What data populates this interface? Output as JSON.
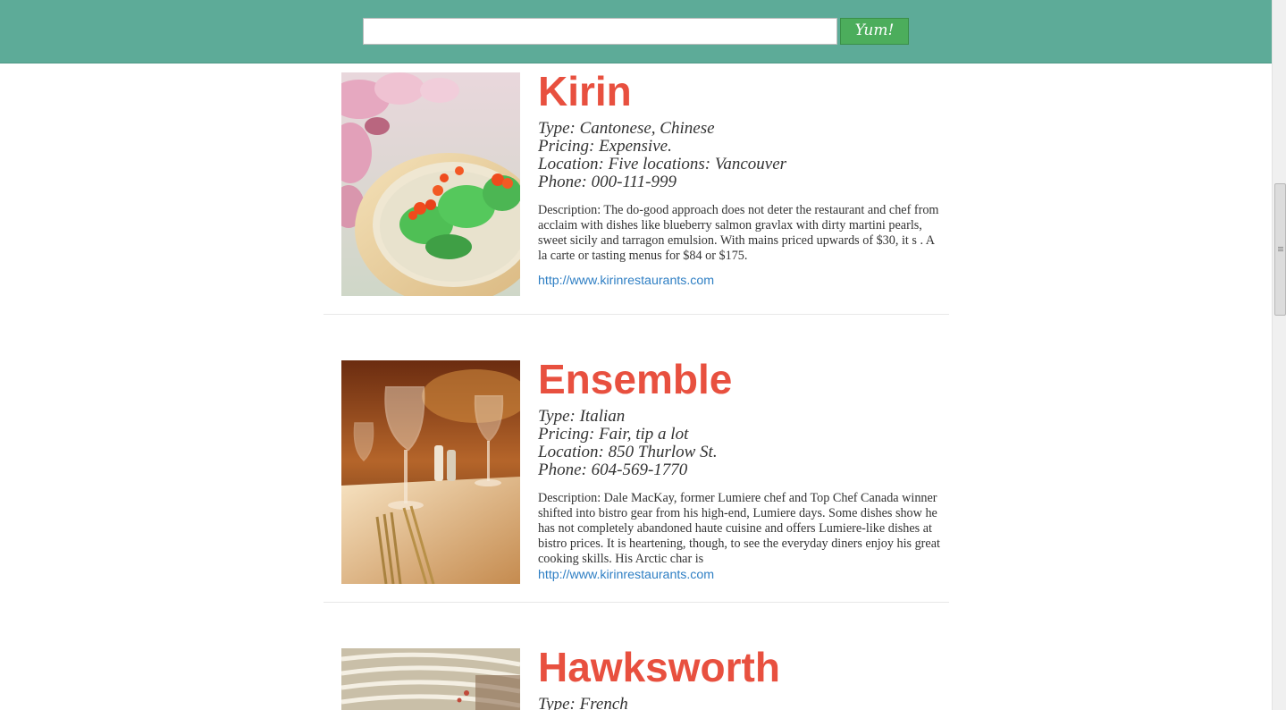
{
  "search": {
    "value": "",
    "placeholder": "",
    "button_label": "Yum!"
  },
  "restaurants": [
    {
      "name": "Kirin",
      "type": "Type: Cantonese, Chinese",
      "pricing": "Pricing: Expensive.",
      "location": "Location: Five locations: Vancouver",
      "phone": "Phone: 000-111-999",
      "description": "Description: The do-good approach does not deter the restaurant and chef from acclaim with dishes like blueberry salmon gravlax with dirty martini pearls, sweet sicily and tarragon emulsion. With mains priced upwards of $30, it s . A la carte or tasting menus for $84 or $175.",
      "link": "http://www.kirinrestaurants.com"
    },
    {
      "name": "Ensemble",
      "type": "Type: Italian",
      "pricing": "Pricing: Fair, tip a lot",
      "location": "Location: 850 Thurlow St.",
      "phone": "Phone: 604-569-1770",
      "description": "Description: Dale MacKay, former Lumiere chef and Top Chef Canada winner shifted into bistro gear from his high-end, Lumiere days. Some dishes show he has not completely abandoned haute cuisine and offers Lumiere-like dishes at bistro prices. It is heartening, though, to see the everyday diners enjoy his great cooking skills. His Arctic char is",
      "link": "http://www.kirinrestaurants.com"
    },
    {
      "name": "Hawksworth",
      "type": "Type: French"
    }
  ],
  "colors": {
    "header_bg": "#5dab98",
    "button_bg": "#4cad5c",
    "title_red": "#e8503f",
    "link_blue": "#2f7fc4"
  }
}
